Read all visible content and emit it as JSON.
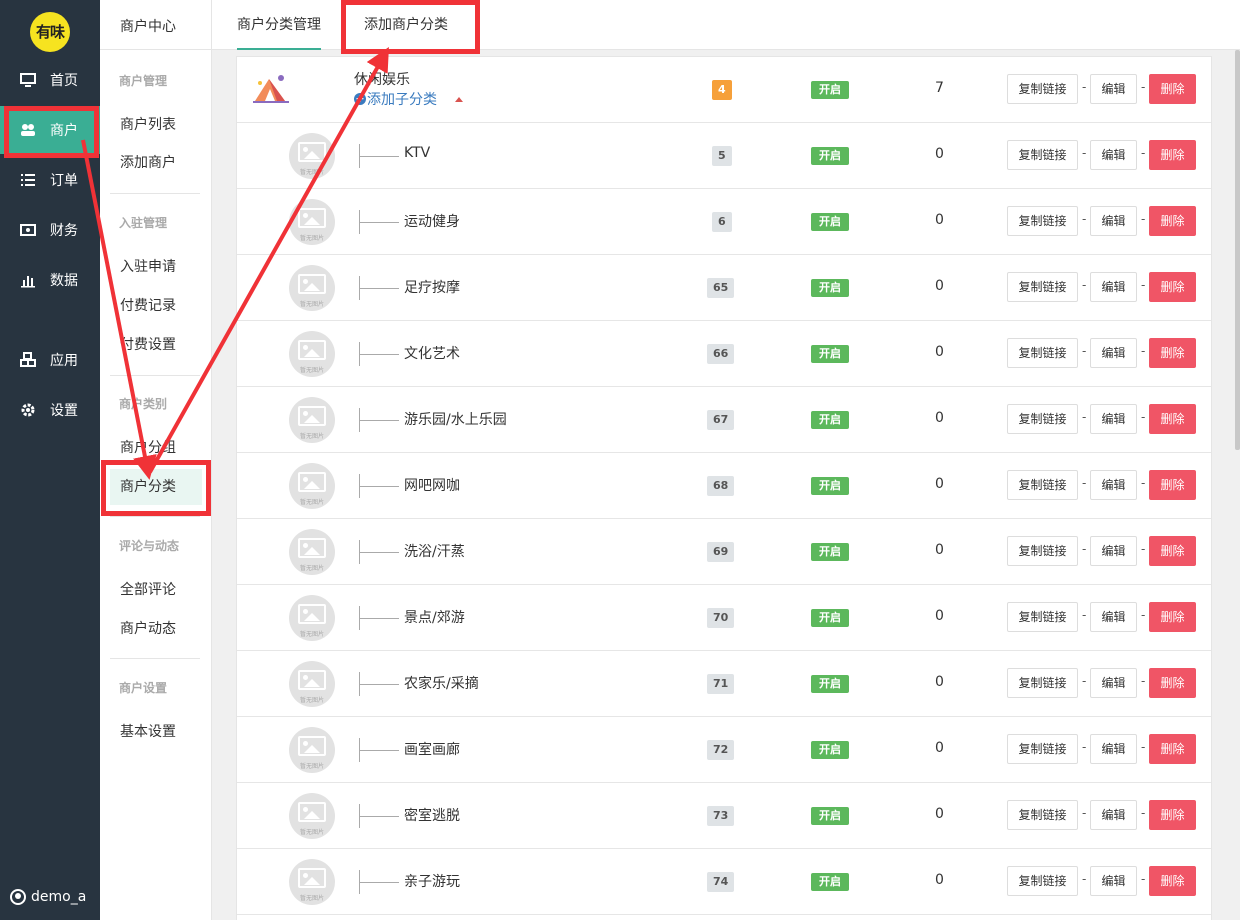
{
  "sidebar": {
    "logo": "有味",
    "items": [
      {
        "label": "首页",
        "icon": "monitor-icon"
      },
      {
        "label": "商户",
        "icon": "users-icon"
      },
      {
        "label": "订单",
        "icon": "list-icon"
      },
      {
        "label": "财务",
        "icon": "money-icon"
      },
      {
        "label": "数据",
        "icon": "bar-chart-icon"
      },
      {
        "label": "应用",
        "icon": "cubes-icon"
      },
      {
        "label": "设置",
        "icon": "gear-icon"
      }
    ],
    "active_index": 1,
    "user": "demo_a",
    "accent_color": "#3aae94"
  },
  "subnav": {
    "title": "商户中心",
    "groups": [
      {
        "title": "商户管理",
        "items": [
          "商户列表",
          "添加商户"
        ]
      },
      {
        "title": "入驻管理",
        "items": [
          "入驻申请",
          "付费记录",
          "付费设置"
        ]
      },
      {
        "title": "商户类别",
        "items": [
          "商户分组",
          "商户分类"
        ]
      },
      {
        "title": "评论与动态",
        "items": [
          "全部评论",
          "商户动态"
        ]
      },
      {
        "title": "商户设置",
        "items": [
          "基本设置"
        ]
      }
    ],
    "active_item": "商户分类"
  },
  "tabs": [
    {
      "label": "商户分类管理",
      "active": true
    },
    {
      "label": "添加商户分类",
      "active": false
    }
  ],
  "parent_row": {
    "name": "休闲娱乐",
    "add_sub_label": "添加子分类",
    "sort": "4",
    "status": "开启",
    "count": "7",
    "icon": "tent-icon"
  },
  "rows": [
    {
      "name": "KTV",
      "sort": "5",
      "status": "开启",
      "count": "0"
    },
    {
      "name": "运动健身",
      "sort": "6",
      "status": "开启",
      "count": "0"
    },
    {
      "name": "足疗按摩",
      "sort": "65",
      "status": "开启",
      "count": "0"
    },
    {
      "name": "文化艺术",
      "sort": "66",
      "status": "开启",
      "count": "0"
    },
    {
      "name": "游乐园/水上乐园",
      "sort": "67",
      "status": "开启",
      "count": "0"
    },
    {
      "name": "网吧网咖",
      "sort": "68",
      "status": "开启",
      "count": "0"
    },
    {
      "name": "洗浴/汗蒸",
      "sort": "69",
      "status": "开启",
      "count": "0"
    },
    {
      "name": "景点/郊游",
      "sort": "70",
      "status": "开启",
      "count": "0"
    },
    {
      "name": "农家乐/采摘",
      "sort": "71",
      "status": "开启",
      "count": "0"
    },
    {
      "name": "画室画廊",
      "sort": "72",
      "status": "开启",
      "count": "0"
    },
    {
      "name": "密室逃脱",
      "sort": "73",
      "status": "开启",
      "count": "0"
    },
    {
      "name": "亲子游玩",
      "sort": "74",
      "status": "开启",
      "count": "0"
    }
  ],
  "placeholder_caption": "暂无图片",
  "actions": {
    "copy": "复制链接",
    "edit": "编辑",
    "delete": "删除",
    "separator": "-"
  },
  "colors": {
    "status_on": "#5cb85c",
    "delete": "#f05566",
    "annotation": "#f03237",
    "link": "#3a7bbf"
  }
}
